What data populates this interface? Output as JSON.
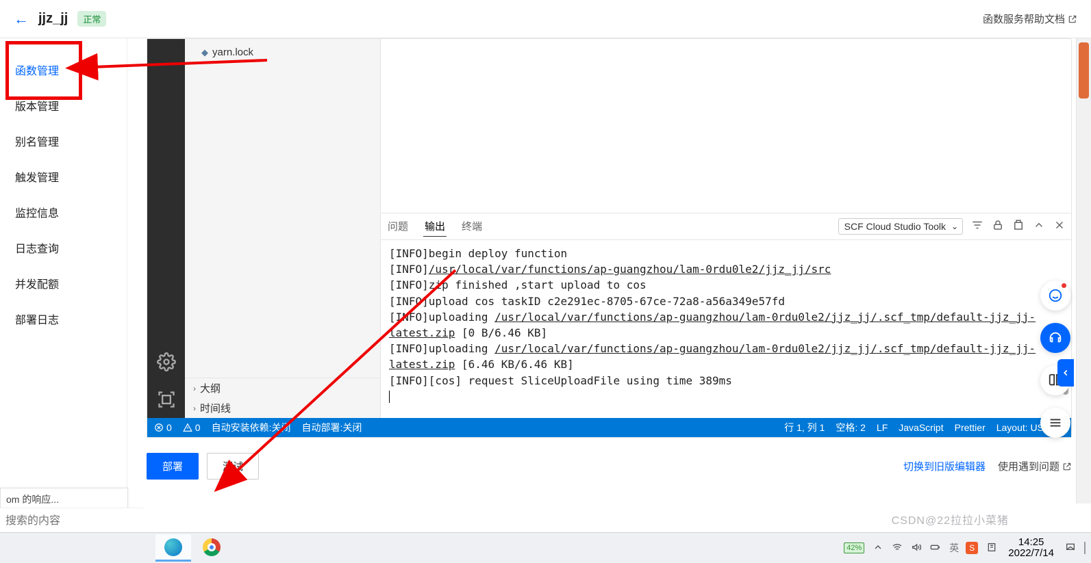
{
  "header": {
    "title": "jjz_jj",
    "status": "正常",
    "help_link": "函数服务帮助文档"
  },
  "sidebar": {
    "items": [
      {
        "label": "函数管理",
        "active": true
      },
      {
        "label": "版本管理",
        "active": false
      },
      {
        "label": "别名管理",
        "active": false
      },
      {
        "label": "触发管理",
        "active": false
      },
      {
        "label": "监控信息",
        "active": false
      },
      {
        "label": "日志查询",
        "active": false
      },
      {
        "label": "并发配额",
        "active": false
      },
      {
        "label": "部署日志",
        "active": false
      }
    ]
  },
  "explorer": {
    "file": "yarn.lock",
    "outline": "大纲",
    "timeline": "时间线"
  },
  "terminal": {
    "tabs": {
      "problems": "问题",
      "output": "输出",
      "terminal": "终端"
    },
    "selector": "SCF Cloud Studio Toolk",
    "lines": {
      "l1_a": "[INFO]begin deploy function",
      "l2_a": "[INFO]",
      "l2_u": "/usr/local/var/functions/ap-guangzhou/lam-0rdu0le2/jjz_jj/src",
      "l3_a": "[INFO]zip finished ,start upload to cos",
      "l4_a": "[INFO]upload cos taskID c2e291ec-8705-67ce-72a8-a56a349e57fd",
      "l5_a": "[INFO]uploading ",
      "l5_u": "/usr/local/var/functions/ap-guangzhou/lam-0rdu0le2/jjz_jj/.scf_tmp/default-jjz_jj-latest.zip",
      "l5_b": " [0 B/6.46 KB]",
      "l6_a": "[INFO]uploading ",
      "l6_u": "/usr/local/var/functions/ap-guangzhou/lam-0rdu0le2/jjz_jj/.scf_tmp/default-jjz_jj-latest.zip",
      "l6_b": " [6.46 KB/6.46 KB]",
      "l7_a": "[INFO][cos] request SliceUploadFile using time 389ms"
    }
  },
  "statusbar": {
    "errors": "0",
    "warnings": "0",
    "auto_install": "自动安装依赖:关闭",
    "auto_deploy": "自动部署:关闭",
    "line_col": "行 1, 列 1",
    "spaces": "空格: 2",
    "eol": "LF",
    "lang": "JavaScript",
    "prettier": "Prettier",
    "layout": "Layout: US"
  },
  "footer": {
    "deploy": "部署",
    "test": "测试",
    "switch_editor": "切换到旧版编辑器",
    "feedback": "使用遇到问题"
  },
  "misc": {
    "resp_label": "om 的响应...",
    "search_placeholder": "搜索的内容"
  },
  "taskbar": {
    "battery": "42%",
    "time": "14:25",
    "date": "2022/7/14",
    "ime": "英"
  },
  "watermark": "CSDN@22拉拉小菜猪"
}
